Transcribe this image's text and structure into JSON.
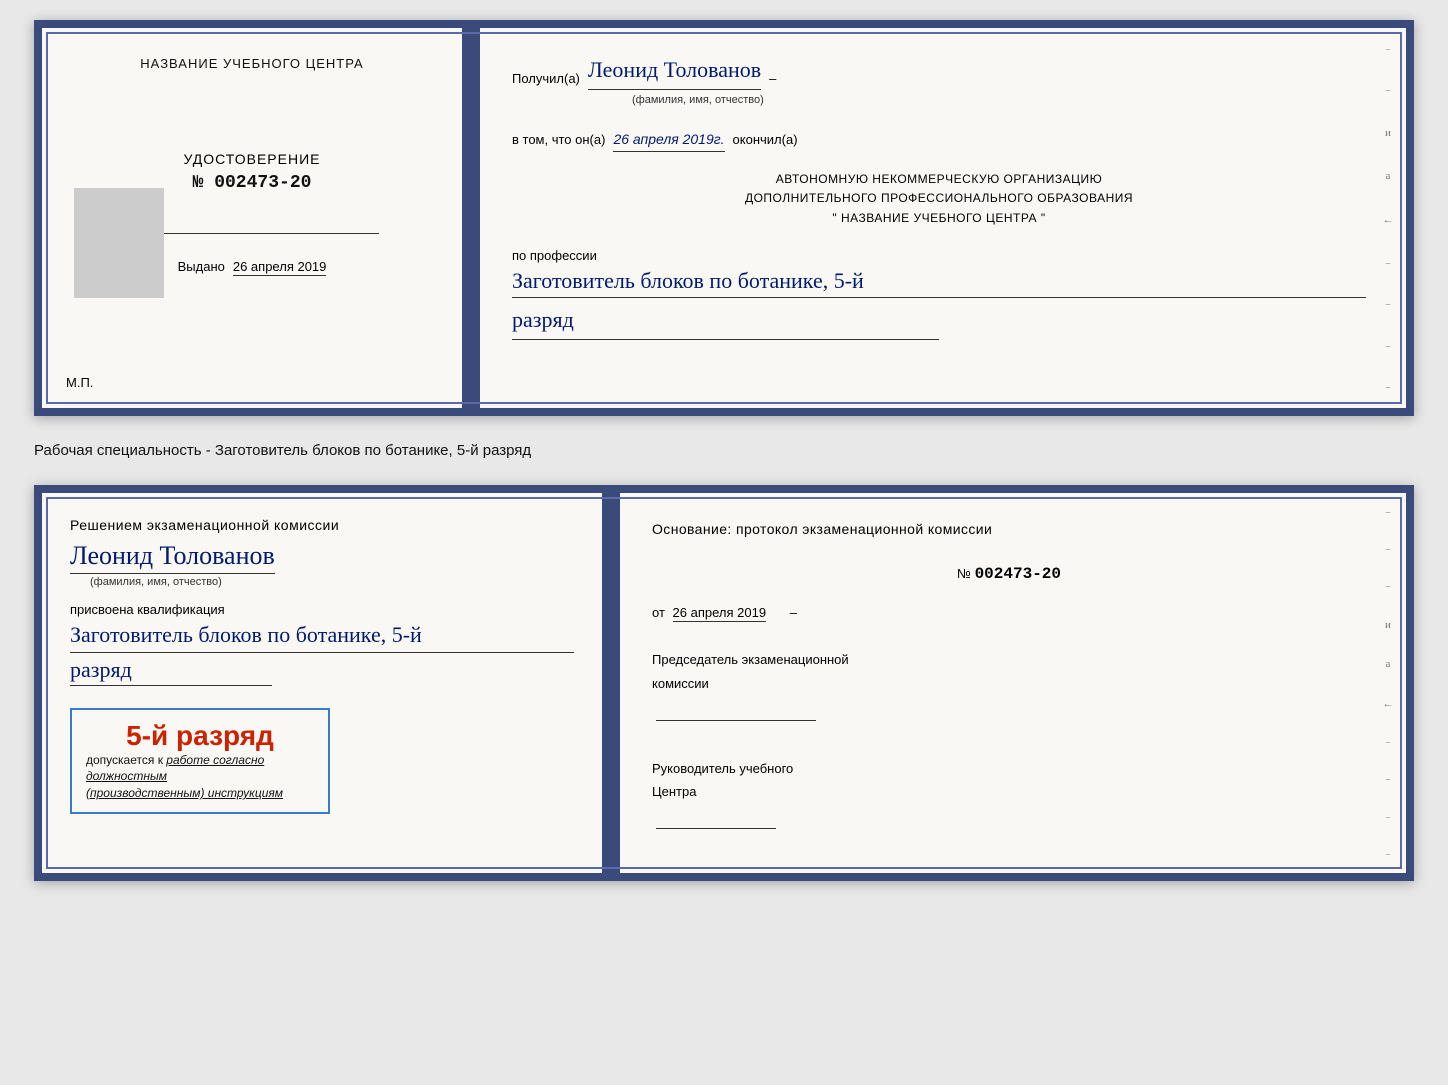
{
  "doc1": {
    "left": {
      "heading": "НАЗВАНИЕ УЧЕБНОГО ЦЕНТРА",
      "cert_label": "УДОСТОВЕРЕНИЕ",
      "cert_number_prefix": "№",
      "cert_number": "002473-20",
      "issued_label": "Выдано",
      "issued_date": "26 апреля 2019",
      "mp_label": "М.П."
    },
    "right": {
      "received_prefix": "Получил(а)",
      "recipient_name": "Леонид Толованов",
      "name_sub": "(фамилия, имя, отчество)",
      "dash": "–",
      "completed_prefix": "в том, что он(а)",
      "completed_date": "26 апреля 2019г.",
      "completed_suffix": "окончил(а)",
      "org_line1": "АВТОНОМНУЮ НЕКОММЕРЧЕСКУЮ ОРГАНИЗАЦИЮ",
      "org_line2": "ДОПОЛНИТЕЛЬНОГО ПРОФЕССИОНАЛЬНОГО ОБРАЗОВАНИЯ",
      "org_name": "\" НАЗВАНИЕ УЧЕБНОГО ЦЕНТРА \"",
      "profession_label": "по профессии",
      "profession_name": "Заготовитель блоков по ботанике, 5-й",
      "rank": "разряд"
    }
  },
  "specialty_text": "Рабочая специальность - Заготовитель блоков по ботанике, 5-й разряд",
  "doc2": {
    "left": {
      "decision_prefix": "Решением экзаменационной комиссии",
      "recipient_name": "Леонид Толованов",
      "name_sub": "(фамилия, имя, отчество)",
      "assigned_label": "присвоена квалификация",
      "profession": "Заготовитель блоков по ботанике, 5-й",
      "rank": "разряд",
      "stamp_rank": "5-й разряд",
      "stamp_prefix": "допускается к",
      "stamp_italic": "работе согласно должностным",
      "stamp_italic2": "(производственным) инструкциям"
    },
    "right": {
      "basis_label": "Основание: протокол экзаменационной комиссии",
      "number_prefix": "№",
      "number": "002473-20",
      "date_prefix": "от",
      "date": "26 апреля 2019",
      "chairman_label": "Председатель экзаменационной",
      "chairman_label2": "комиссии",
      "director_label": "Руководитель учебного",
      "director_label2": "Центра"
    }
  },
  "margin_chars": {
    "i": "и",
    "a": "а",
    "arrow": "←",
    "dashes": [
      "–",
      "–",
      "–",
      "–",
      "–",
      "–"
    ]
  }
}
